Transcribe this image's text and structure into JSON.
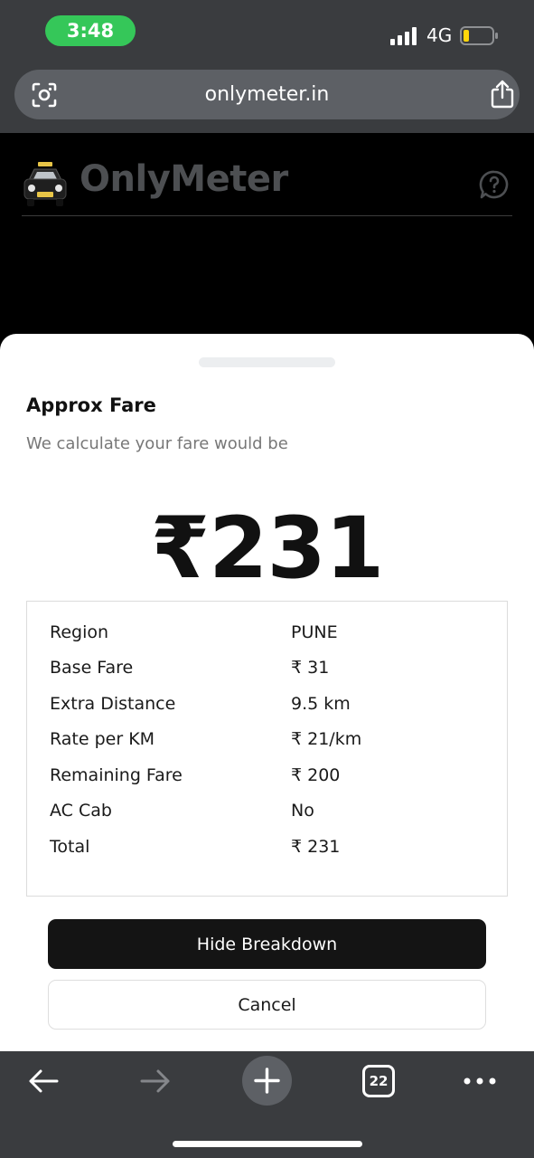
{
  "status_bar": {
    "time": "3:48",
    "network": "4G"
  },
  "browser": {
    "url": "onlymeter.in",
    "tab_count": "22"
  },
  "app": {
    "brand": "OnlyMeter"
  },
  "sheet": {
    "title": "Approx Fare",
    "subtitle": "We calculate your fare would be",
    "amount": "₹231",
    "breakdown": [
      {
        "label": "Region",
        "value": "PUNE"
      },
      {
        "label": "Base Fare",
        "value": "₹ 31"
      },
      {
        "label": "Extra Distance",
        "value": "9.5 km"
      },
      {
        "label": "Rate per KM",
        "value": "₹ 21/km"
      },
      {
        "label": "Remaining Fare",
        "value": "₹ 200"
      },
      {
        "label": "AC Cab",
        "value": "No"
      },
      {
        "label": "Total",
        "value": "₹ 231"
      }
    ],
    "hide_breakdown_label": "Hide Breakdown",
    "cancel_label": "Cancel"
  },
  "colors": {
    "time_pill": "#35c759",
    "browser_chrome": "#3a3c3f",
    "primary_button": "#141414"
  },
  "icons": [
    "lens-icon",
    "share-icon",
    "taxi-icon",
    "help-icon",
    "back-icon",
    "forward-icon",
    "plus-icon",
    "more-icon"
  ]
}
